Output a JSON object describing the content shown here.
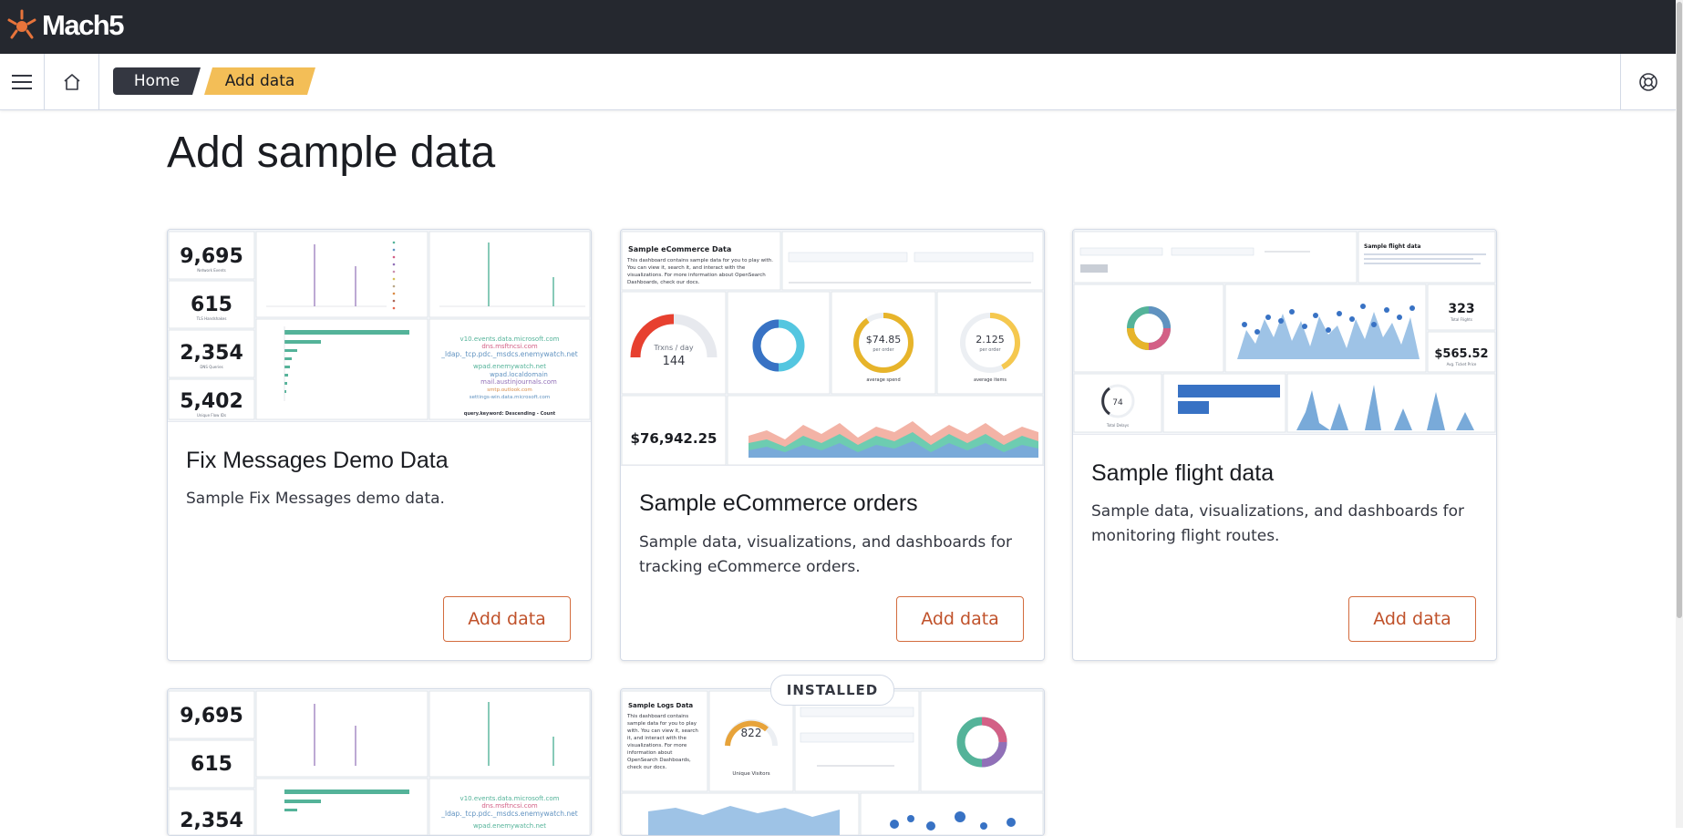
{
  "app": {
    "name": "Mach5"
  },
  "breadcrumbs": [
    {
      "label": "Home"
    },
    {
      "label": "Add data"
    }
  ],
  "page": {
    "title": "Add sample data"
  },
  "cards": [
    {
      "title": "Fix Messages Demo Data",
      "description": "Sample Fix Messages demo data.",
      "button": "Add data"
    },
    {
      "title": "Sample eCommerce orders",
      "description": "Sample data, visualizations, and dashboards for tracking eCommerce orders.",
      "button": "Add data"
    },
    {
      "title": "Sample flight data",
      "description": "Sample data, visualizations, and dashboards for monitoring flight routes.",
      "button": "Add data"
    }
  ],
  "installed_badge": "INSTALLED",
  "thumb_security": {
    "metrics": [
      {
        "value": "9,695",
        "label": "Network Events"
      },
      {
        "value": "615",
        "label": "TLS Handshakes"
      },
      {
        "value": "2,354",
        "label": "DNS Queries"
      },
      {
        "value": "5,402",
        "label": "Unique Flow IDs"
      }
    ],
    "domains": [
      "v10.events.data.microsoft.com",
      "dns.msftncsi.com",
      "_ldap._tcp.pdc._msdcs.enemywatch.net",
      "wpad.enemywatch.net",
      "wpad.localdomain",
      "mail.austinjournals.com",
      "smtp.outlook.com",
      "settings-win.data.microsoft.com"
    ],
    "footer": "query.keyword: Descending - Count"
  },
  "thumb_ecommerce": {
    "markdown_title": "Sample eCommerce Data",
    "markdown_text": "This dashboard contains sample data for you to play with. You can view it, search it, and interact with the visualizations. For more information about OpenSearch Dashboards, check our docs.",
    "gauge_label": "Trxns / day",
    "gauge_value": "144",
    "avg_sales_price": "$74.85",
    "avg_sales_price_unit": "per order",
    "avg_sales_price_label": "average spend",
    "avg_sold_qty": "2.125",
    "avg_sold_qty_unit": "per order",
    "avg_sold_qty_label": "average items",
    "total_revenue": "$76,942.25"
  },
  "thumb_flights": {
    "title": "Sample flight data",
    "total_flights": "323",
    "total_flights_label": "Total Flights",
    "avg_ticket_price": "$565.52",
    "avg_ticket_price_label": "Avg. Ticket Price",
    "delays": "74",
    "delays_label": "Total Delays"
  },
  "thumb_logs": {
    "title": "Sample Logs Data",
    "text": "This dashboard contains sample data for you to play with. You can view it, search it, and interact with the visualizations. For more information about OpenSearch Dashboards, check our docs.",
    "gauge_value": "822",
    "gauge_label": "Unique Visitors"
  },
  "colors": {
    "accent": "#c0522b",
    "topbar": "#25282f",
    "breadcrumb_active": "#f3be57"
  }
}
